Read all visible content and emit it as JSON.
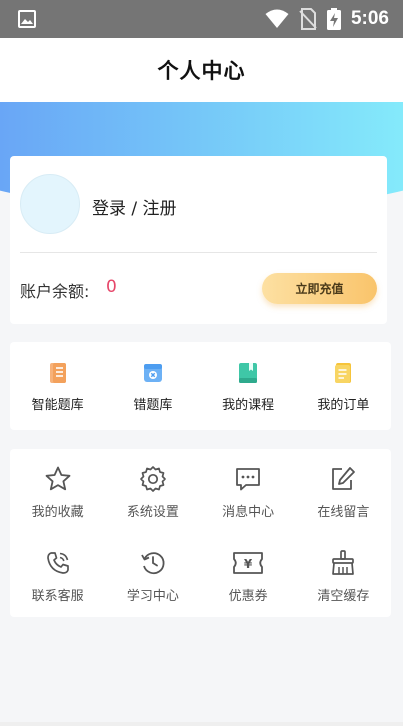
{
  "status_bar": {
    "time": "5:06"
  },
  "nav": {
    "title": "个人中心"
  },
  "account": {
    "login_label": "登录 / 注册",
    "balance_label": "账户余额:",
    "balance_value": "0",
    "recharge_label": "立即充值"
  },
  "quick_actions": [
    {
      "label": "智能题库",
      "icon": "smart-question-bank-icon",
      "color": "#f3a15c"
    },
    {
      "label": "错题库",
      "icon": "wrong-question-bank-icon",
      "color": "#4d9df0"
    },
    {
      "label": "我的课程",
      "icon": "my-courses-icon",
      "color": "#3fc7a7"
    },
    {
      "label": "我的订单",
      "icon": "my-orders-icon",
      "color": "#f6c43b"
    }
  ],
  "menu": [
    {
      "label": "我的收藏",
      "icon": "star-icon"
    },
    {
      "label": "系统设置",
      "icon": "gear-icon"
    },
    {
      "label": "消息中心",
      "icon": "message-icon"
    },
    {
      "label": "在线留言",
      "icon": "edit-icon"
    },
    {
      "label": "联系客服",
      "icon": "phone-icon"
    },
    {
      "label": "学习中心",
      "icon": "history-clock-icon"
    },
    {
      "label": "优惠券",
      "icon": "coupon-icon"
    },
    {
      "label": "清空缓存",
      "icon": "broom-icon"
    }
  ]
}
